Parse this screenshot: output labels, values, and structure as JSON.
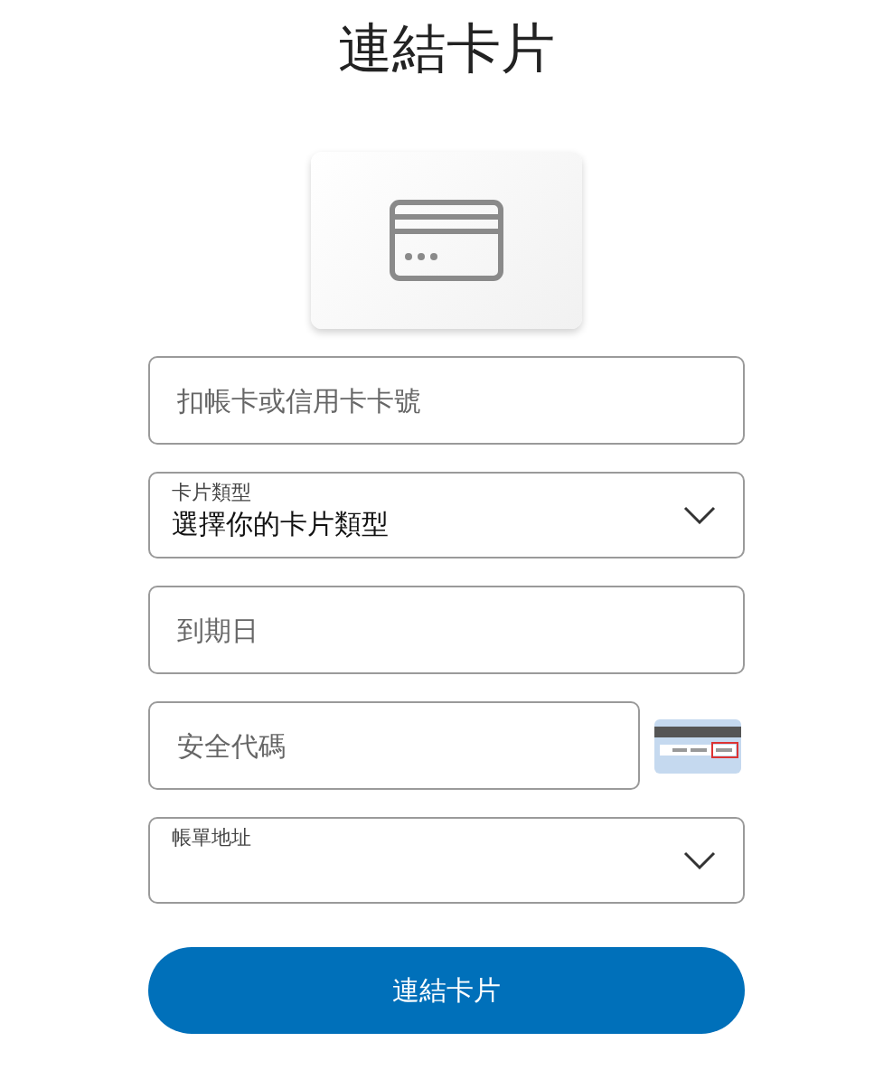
{
  "title": "連結卡片",
  "fields": [
    {
      "kind": "text",
      "placeholder": "扣帳卡或信用卡卡號"
    },
    {
      "kind": "select",
      "label": "卡片類型",
      "value": "選擇你的卡片類型"
    },
    {
      "kind": "text",
      "placeholder": "到期日"
    },
    {
      "kind": "cvv",
      "placeholder": "安全代碼"
    },
    {
      "kind": "select",
      "label": "帳單地址"
    }
  ],
  "submit": "連結卡片"
}
